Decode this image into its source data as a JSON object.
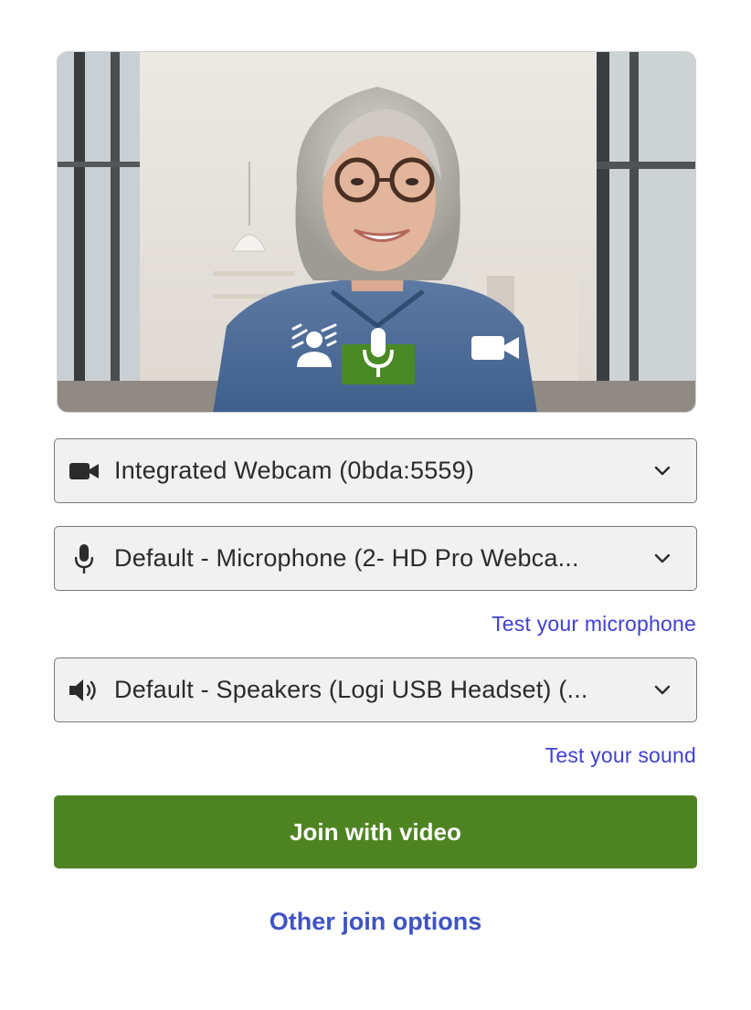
{
  "preview": {
    "controls": [
      {
        "name": "background-effects",
        "icon": "person-background-icon"
      },
      {
        "name": "microphone",
        "icon": "microphone-icon",
        "active_color": "#4a8a24"
      },
      {
        "name": "camera",
        "icon": "video-camera-icon"
      }
    ]
  },
  "devices": {
    "camera": {
      "icon": "video-camera-icon",
      "value": "Integrated Webcam (0bda:5559)"
    },
    "microphone": {
      "icon": "microphone-icon",
      "value": "Default - Microphone (2- HD Pro Webca..."
    },
    "speaker": {
      "icon": "speaker-icon",
      "value": "Default - Speakers (Logi USB Headset) (..."
    }
  },
  "links": {
    "test_microphone": "Test your microphone",
    "test_sound": "Test your sound"
  },
  "actions": {
    "join_with_video": "Join with video",
    "other_join_options": "Other join options"
  },
  "colors": {
    "primary_green": "#4d8421",
    "link_blue": "#3f3fd6",
    "other_link_blue": "#3f53c4"
  }
}
